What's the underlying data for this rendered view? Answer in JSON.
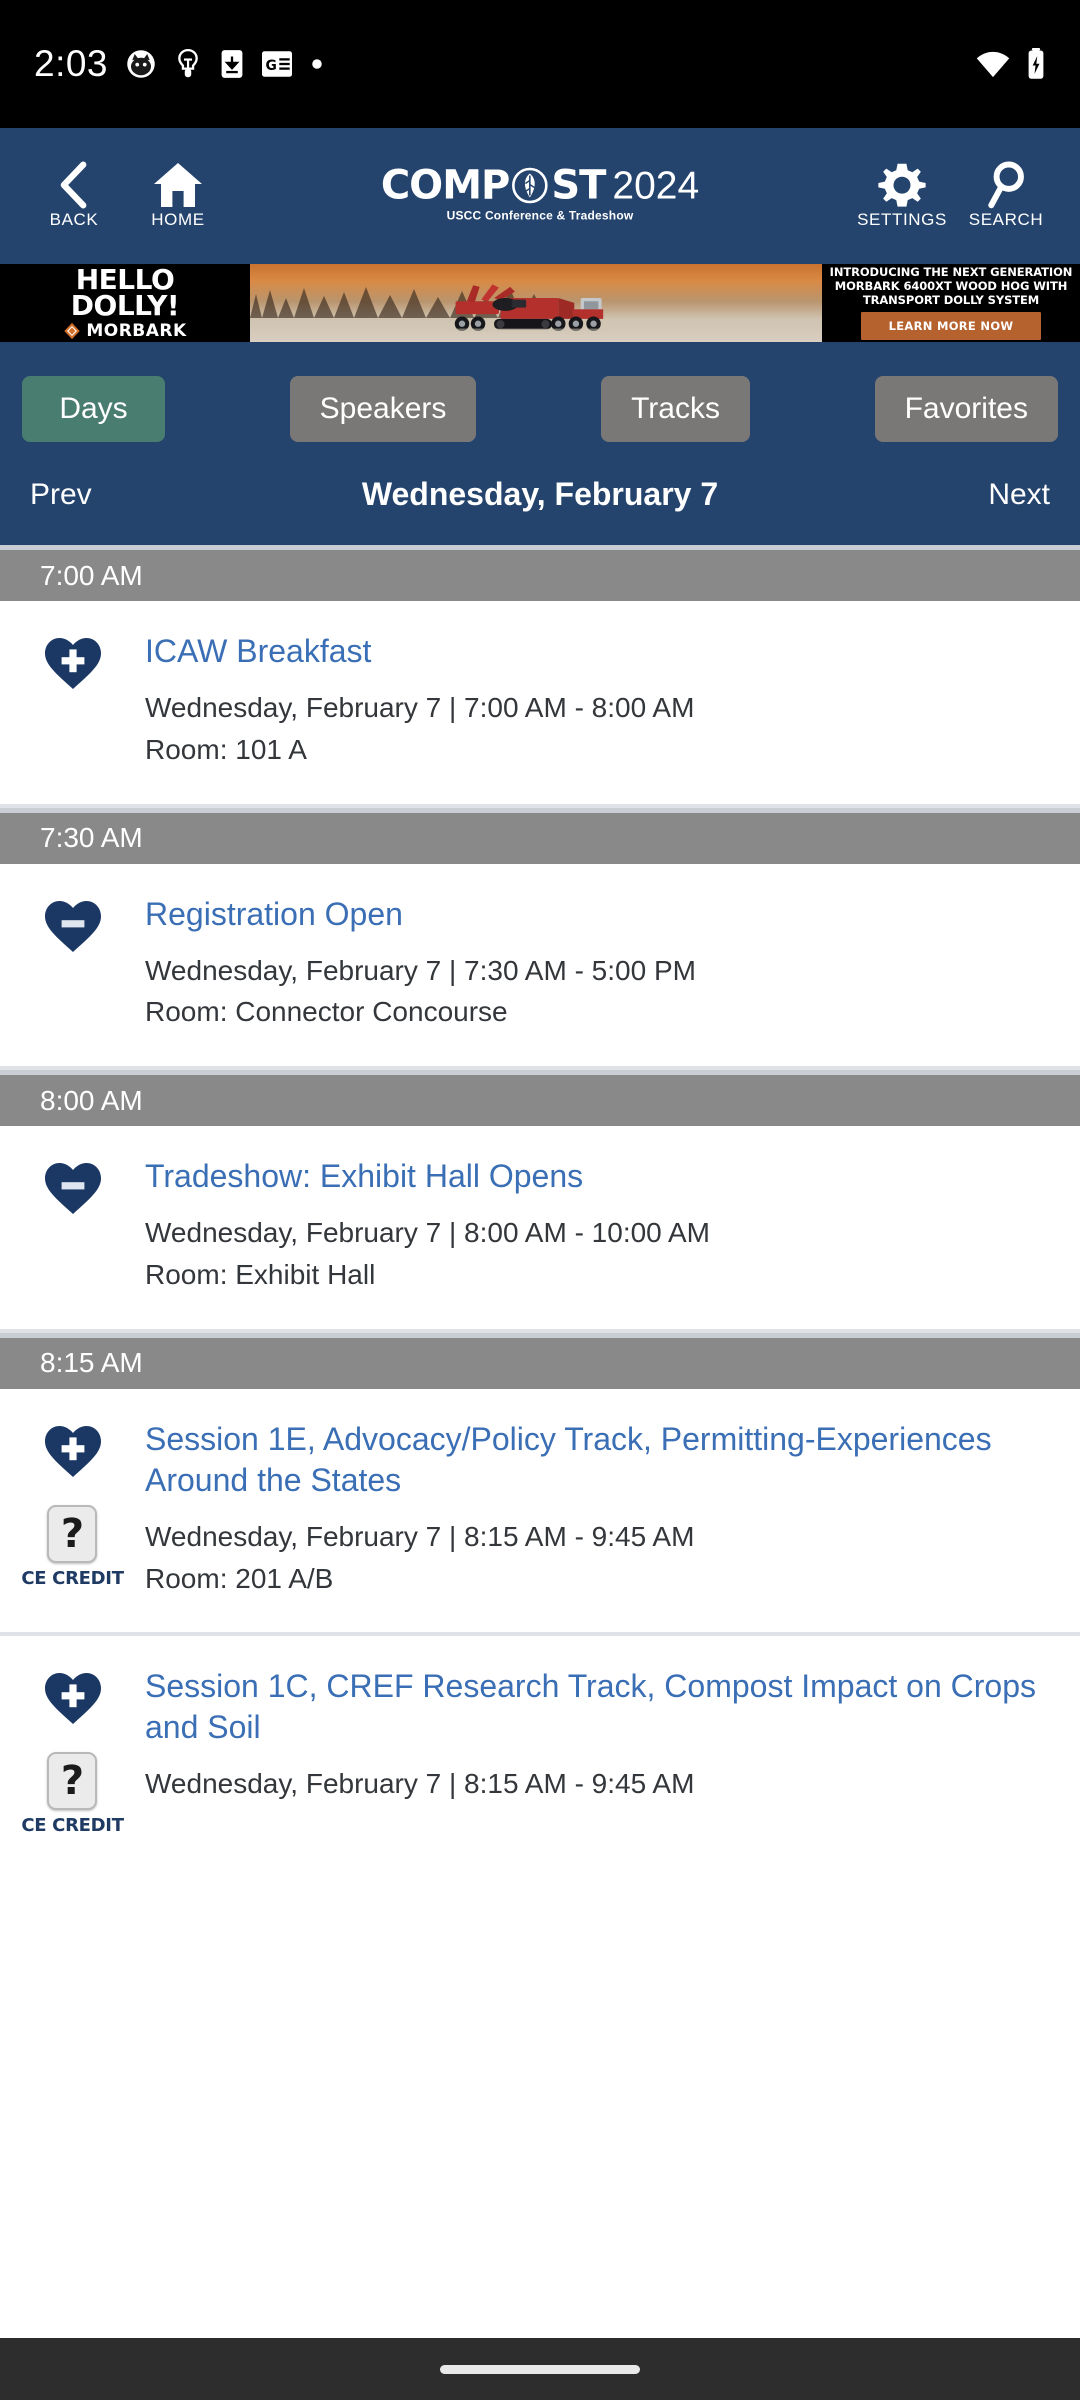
{
  "status_bar": {
    "time": "2:03",
    "left_icons": [
      "cat-avatar-icon",
      "lightbulb-icon",
      "phone-download-icon",
      "google-news-icon",
      "dot-icon"
    ],
    "right_icons": [
      "wifi-icon",
      "battery-charging-icon"
    ]
  },
  "header": {
    "back_label": "BACK",
    "home_label": "HOME",
    "settings_label": "SETTINGS",
    "search_label": "SEARCH",
    "logo_main": "COMP",
    "logo_main_tail": "ST",
    "logo_year": "2024",
    "logo_subtitle": "USCC Conference & Tradeshow",
    "background_color": "#24446e"
  },
  "banner_ad": {
    "headline_line1": "HELLO",
    "headline_line2": "DOLLY!",
    "brand": "MORBARK",
    "copy_line1": "INTRODUCING THE NEXT GENERATION",
    "copy_line2": "MORBARK 6400XT WOOD HOG WITH",
    "copy_line3": "TRANSPORT DOLLY SYSTEM",
    "cta_label": "LEARN MORE NOW",
    "cta_color": "#b5622f"
  },
  "tabs": [
    {
      "label": "Days",
      "active": true
    },
    {
      "label": "Speakers",
      "active": false
    },
    {
      "label": "Tracks",
      "active": false
    },
    {
      "label": "Favorites",
      "active": false
    }
  ],
  "tab_colors": {
    "active": "#497d6f",
    "inactive": "#7a7876"
  },
  "day_nav": {
    "prev_label": "Prev",
    "current_day": "Wednesday, February 7",
    "next_label": "Next"
  },
  "agenda": [
    {
      "time_header": "7:00 AM",
      "events": [
        {
          "favorite_icon": "heart-plus-icon",
          "title": "ICAW Breakfast",
          "meta": "Wednesday, February 7 | 7:00 AM - 8:00 AM",
          "room": "Room: 101 A",
          "ce_credit": false,
          "ce_label": ""
        }
      ]
    },
    {
      "time_header": "7:30 AM",
      "events": [
        {
          "favorite_icon": "heart-minus-icon",
          "title": "Registration Open",
          "meta": "Wednesday, February 7 | 7:30 AM - 5:00 PM",
          "room": "Room: Connector Concourse",
          "ce_credit": false,
          "ce_label": ""
        }
      ]
    },
    {
      "time_header": "8:00 AM",
      "events": [
        {
          "favorite_icon": "heart-minus-icon",
          "title": "Tradeshow: Exhibit Hall Opens",
          "meta": "Wednesday, February 7 | 8:00 AM - 10:00 AM",
          "room": "Room: Exhibit Hall",
          "ce_credit": false,
          "ce_label": ""
        }
      ]
    },
    {
      "time_header": "8:15 AM",
      "events": [
        {
          "favorite_icon": "heart-plus-icon",
          "title": "Session 1E, Advocacy/Policy Track, Permitting-Experiences Around the States",
          "meta": "Wednesday, February 7 | 8:15 AM - 9:45 AM",
          "room": "Room: 201 A/B",
          "ce_credit": true,
          "ce_label": "CE CREDIT"
        },
        {
          "favorite_icon": "heart-plus-icon",
          "title": "Session 1C, CREF Research Track, Compost Impact on Crops and Soil",
          "meta": "Wednesday, February 7 | 8:15 AM - 9:45 AM",
          "room": "",
          "ce_credit": true,
          "ce_label": "CE CREDIT"
        }
      ]
    }
  ],
  "colors": {
    "header_blue": "#24446e",
    "time_header_gray": "#898989",
    "link_blue": "#3a6eb5",
    "heart_navy": "#1b3864",
    "body_text": "#33363a"
  }
}
